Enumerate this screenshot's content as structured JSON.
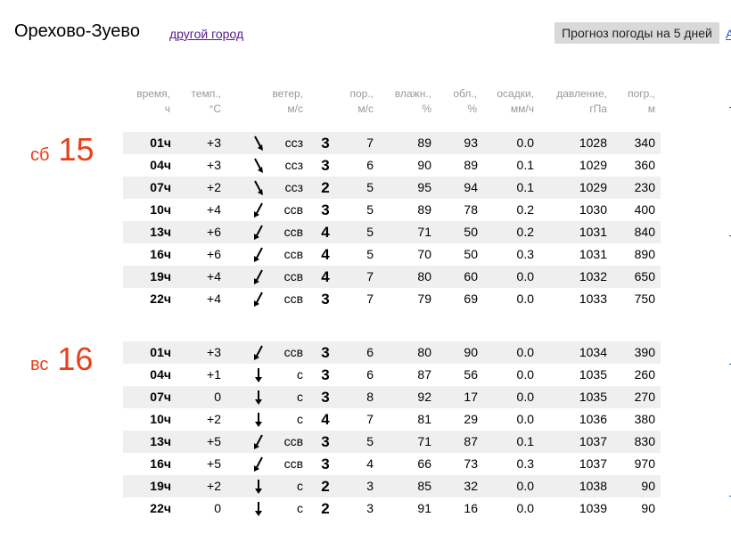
{
  "city": "Орехово-Зуево",
  "other_city_link": "другой город",
  "forecast_button": "Прогноз погоды на 5 дней",
  "edge_link": "А",
  "headers": [
    {
      "l1": "время,",
      "l2": "ч"
    },
    {
      "l1": "темп.,",
      "l2": "°С"
    },
    {
      "l1": "ветер,",
      "l2": "м/с"
    },
    {
      "l1": "пор.,",
      "l2": "м/с"
    },
    {
      "l1": "влажн.,",
      "l2": "%"
    },
    {
      "l1": "обл.,",
      "l2": "%"
    },
    {
      "l1": "осадки,",
      "l2": "мм/ч"
    },
    {
      "l1": "давление,",
      "l2": "гПа"
    },
    {
      "l1": "погр.,",
      "l2": "м"
    }
  ],
  "days": [
    {
      "day_name": "сб",
      "day_num": "15",
      "rows": [
        {
          "time": "01ч",
          "temp": "+3",
          "arrow": "ssz",
          "dir": "ссз",
          "speed": "3",
          "gust": "7",
          "hum": "89",
          "cloud": "93",
          "prec": "0.0",
          "pres": "1028",
          "alt": "340"
        },
        {
          "time": "04ч",
          "temp": "+3",
          "arrow": "ssz",
          "dir": "ссз",
          "speed": "3",
          "gust": "6",
          "hum": "90",
          "cloud": "89",
          "prec": "0.1",
          "pres": "1029",
          "alt": "360"
        },
        {
          "time": "07ч",
          "temp": "+2",
          "arrow": "ssz",
          "dir": "ссз",
          "speed": "2",
          "gust": "5",
          "hum": "95",
          "cloud": "94",
          "prec": "0.1",
          "pres": "1029",
          "alt": "230"
        },
        {
          "time": "10ч",
          "temp": "+4",
          "arrow": "ssv",
          "dir": "ссв",
          "speed": "3",
          "gust": "5",
          "hum": "89",
          "cloud": "78",
          "prec": "0.2",
          "pres": "1030",
          "alt": "400"
        },
        {
          "time": "13ч",
          "temp": "+6",
          "arrow": "ssv",
          "dir": "ссв",
          "speed": "4",
          "gust": "5",
          "hum": "71",
          "cloud": "50",
          "prec": "0.2",
          "pres": "1031",
          "alt": "840"
        },
        {
          "time": "16ч",
          "temp": "+6",
          "arrow": "ssv",
          "dir": "ссв",
          "speed": "4",
          "gust": "5",
          "hum": "70",
          "cloud": "50",
          "prec": "0.3",
          "pres": "1031",
          "alt": "890"
        },
        {
          "time": "19ч",
          "temp": "+4",
          "arrow": "ssv",
          "dir": "ссв",
          "speed": "4",
          "gust": "7",
          "hum": "80",
          "cloud": "60",
          "prec": "0.0",
          "pres": "1032",
          "alt": "650"
        },
        {
          "time": "22ч",
          "temp": "+4",
          "arrow": "ssv",
          "dir": "ссв",
          "speed": "3",
          "gust": "7",
          "hum": "79",
          "cloud": "69",
          "prec": "0.0",
          "pres": "1033",
          "alt": "750"
        }
      ]
    },
    {
      "day_name": "вс",
      "day_num": "16",
      "rows": [
        {
          "time": "01ч",
          "temp": "+3",
          "arrow": "ssv",
          "dir": "ссв",
          "speed": "3",
          "gust": "6",
          "hum": "80",
          "cloud": "90",
          "prec": "0.0",
          "pres": "1034",
          "alt": "390"
        },
        {
          "time": "04ч",
          "temp": "+1",
          "arrow": "s",
          "dir": "с",
          "speed": "3",
          "gust": "6",
          "hum": "87",
          "cloud": "56",
          "prec": "0.0",
          "pres": "1035",
          "alt": "260"
        },
        {
          "time": "07ч",
          "temp": "0",
          "arrow": "s",
          "dir": "с",
          "speed": "3",
          "gust": "8",
          "hum": "92",
          "cloud": "17",
          "prec": "0.0",
          "pres": "1035",
          "alt": "270"
        },
        {
          "time": "10ч",
          "temp": "+2",
          "arrow": "s",
          "dir": "с",
          "speed": "4",
          "gust": "7",
          "hum": "81",
          "cloud": "29",
          "prec": "0.0",
          "pres": "1036",
          "alt": "380"
        },
        {
          "time": "13ч",
          "temp": "+5",
          "arrow": "ssv",
          "dir": "ссв",
          "speed": "3",
          "gust": "5",
          "hum": "71",
          "cloud": "87",
          "prec": "0.1",
          "pres": "1037",
          "alt": "830"
        },
        {
          "time": "16ч",
          "temp": "+5",
          "arrow": "ssv",
          "dir": "ссв",
          "speed": "3",
          "gust": "4",
          "hum": "66",
          "cloud": "73",
          "prec": "0.3",
          "pres": "1037",
          "alt": "970"
        },
        {
          "time": "19ч",
          "temp": "+2",
          "arrow": "s",
          "dir": "с",
          "speed": "2",
          "gust": "3",
          "hum": "85",
          "cloud": "32",
          "prec": "0.0",
          "pres": "1038",
          "alt": "90"
        },
        {
          "time": "22ч",
          "temp": "0",
          "arrow": "s",
          "dir": "с",
          "speed": "2",
          "gust": "3",
          "hum": "91",
          "cloud": "16",
          "prec": "0.0",
          "pres": "1039",
          "alt": "90"
        }
      ]
    }
  ]
}
